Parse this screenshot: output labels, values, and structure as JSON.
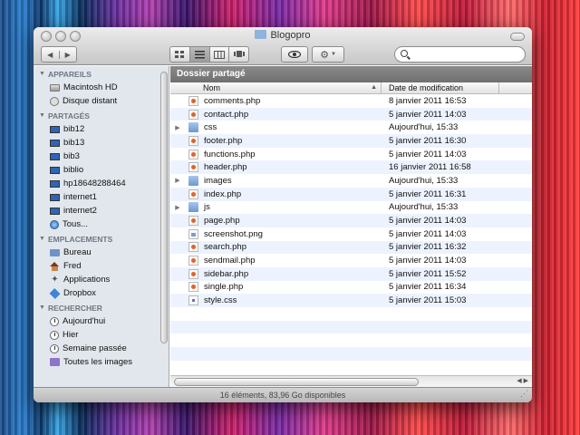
{
  "window": {
    "title": "Blogopro"
  },
  "toolbar": {
    "back_icon": "chevron-left-icon",
    "forward_icon": "chevron-right-icon",
    "view_modes": [
      "icon-view",
      "list-view",
      "column-view",
      "coverflow-view"
    ],
    "active_view": "list-view",
    "quicklook_icon": "eye-icon",
    "action_icon": "gear-icon",
    "search": {
      "value": "",
      "placeholder": ""
    }
  },
  "sidebar": {
    "sections": [
      {
        "title": "APPAREILS",
        "items": [
          {
            "label": "Macintosh HD",
            "icon": "hard-disk-icon"
          },
          {
            "label": "Disque distant",
            "icon": "remote-disk-icon"
          }
        ]
      },
      {
        "title": "PARTAGÉS",
        "items": [
          {
            "label": "bib12",
            "icon": "computer-icon"
          },
          {
            "label": "bib13",
            "icon": "computer-icon"
          },
          {
            "label": "bib3",
            "icon": "computer-icon"
          },
          {
            "label": "biblio",
            "icon": "computer-icon"
          },
          {
            "label": "hp18648288464",
            "icon": "computer-icon"
          },
          {
            "label": "internet1",
            "icon": "computer-icon"
          },
          {
            "label": "internet2",
            "icon": "computer-icon"
          },
          {
            "label": "Tous...",
            "icon": "globe-icon"
          }
        ]
      },
      {
        "title": "EMPLACEMENTS",
        "items": [
          {
            "label": "Bureau",
            "icon": "desktop-folder-icon"
          },
          {
            "label": "Fred",
            "icon": "home-icon"
          },
          {
            "label": "Applications",
            "icon": "applications-icon"
          },
          {
            "label": "Dropbox",
            "icon": "dropbox-icon"
          }
        ]
      },
      {
        "title": "RECHERCHER",
        "items": [
          {
            "label": "Aujourd'hui",
            "icon": "clock-icon"
          },
          {
            "label": "Hier",
            "icon": "clock-icon"
          },
          {
            "label": "Semaine passée",
            "icon": "clock-icon"
          },
          {
            "label": "Toutes les images",
            "icon": "images-folder-icon"
          }
        ]
      }
    ]
  },
  "main": {
    "path_title": "Dossier partagé",
    "columns": {
      "name": "Nom",
      "date": "Date de modification"
    },
    "files": [
      {
        "name": "comments.php",
        "date": "8 janvier 2011 16:53",
        "type": "php"
      },
      {
        "name": "contact.php",
        "date": "5 janvier 2011 14:03",
        "type": "php"
      },
      {
        "name": "css",
        "date": "Aujourd'hui, 15:33",
        "type": "folder"
      },
      {
        "name": "footer.php",
        "date": "5 janvier 2011 16:30",
        "type": "php"
      },
      {
        "name": "functions.php",
        "date": "5 janvier 2011 14:03",
        "type": "php"
      },
      {
        "name": "header.php",
        "date": "16 janvier 2011 16:58",
        "type": "php"
      },
      {
        "name": "images",
        "date": "Aujourd'hui, 15:33",
        "type": "folder"
      },
      {
        "name": "index.php",
        "date": "5 janvier 2011 16:31",
        "type": "php"
      },
      {
        "name": "js",
        "date": "Aujourd'hui, 15:33",
        "type": "folder"
      },
      {
        "name": "page.php",
        "date": "5 janvier 2011 14:03",
        "type": "php"
      },
      {
        "name": "screenshot.png",
        "date": "5 janvier 2011 14:03",
        "type": "png"
      },
      {
        "name": "search.php",
        "date": "5 janvier 2011 16:32",
        "type": "php"
      },
      {
        "name": "sendmail.php",
        "date": "5 janvier 2011 14:03",
        "type": "php"
      },
      {
        "name": "sidebar.php",
        "date": "5 janvier 2011 15:52",
        "type": "php"
      },
      {
        "name": "single.php",
        "date": "5 janvier 2011 16:34",
        "type": "php"
      },
      {
        "name": "style.css",
        "date": "5 janvier 2011 15:03",
        "type": "css"
      }
    ]
  },
  "status": {
    "text": "16 éléments, 83,96 Go disponibles"
  }
}
